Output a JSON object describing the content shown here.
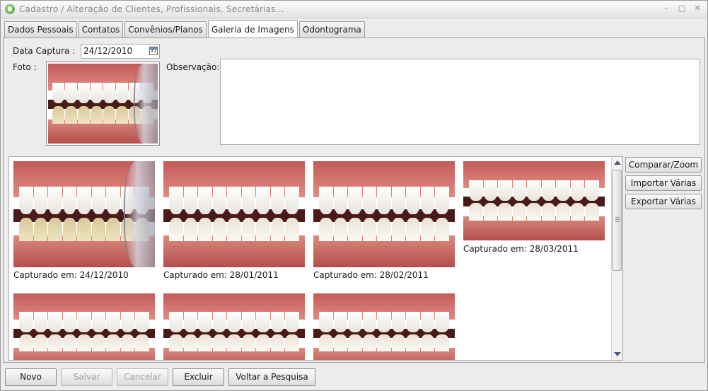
{
  "window": {
    "title": "Cadastro / Alteração de Clientes, Profissionais, Secretárias...",
    "min_label": "–",
    "max_label": "□",
    "close_label": "✕"
  },
  "tabs": [
    {
      "label": "Dados Pessoais",
      "active": false
    },
    {
      "label": "Contatos",
      "active": false
    },
    {
      "label": "Convênios/Planos",
      "active": false
    },
    {
      "label": "Galeria de Imagens",
      "active": true
    },
    {
      "label": "Odontograma",
      "active": false
    }
  ],
  "form": {
    "date_label": "Data Captura :",
    "date_value": "24/12/2010",
    "calendar_icon_text": "31",
    "photo_label": "Foto :",
    "obs_label": "Observação:",
    "obs_value": ""
  },
  "gallery": {
    "items": [
      {
        "caption": "Capturado em:  24/12/2010",
        "variant": "yellow"
      },
      {
        "caption": "Capturado em:  28/01/2011",
        "variant": "white"
      },
      {
        "caption": "Capturado em:  28/02/2011",
        "variant": "white"
      },
      {
        "caption": "Capturado em:  28/03/2011",
        "variant": "white"
      },
      {
        "caption": "",
        "variant": "white"
      },
      {
        "caption": "",
        "variant": "white"
      },
      {
        "caption": "",
        "variant": "white"
      }
    ]
  },
  "side_buttons": {
    "compare": "Comparar/Zoom",
    "import": "Importar Várias",
    "export": "Exportar Várias"
  },
  "bottom_buttons": {
    "novo": "Novo",
    "salvar": "Salvar",
    "cancelar": "Cancelar",
    "excluir": "Excluir",
    "voltar": "Voltar a Pesquisa"
  }
}
